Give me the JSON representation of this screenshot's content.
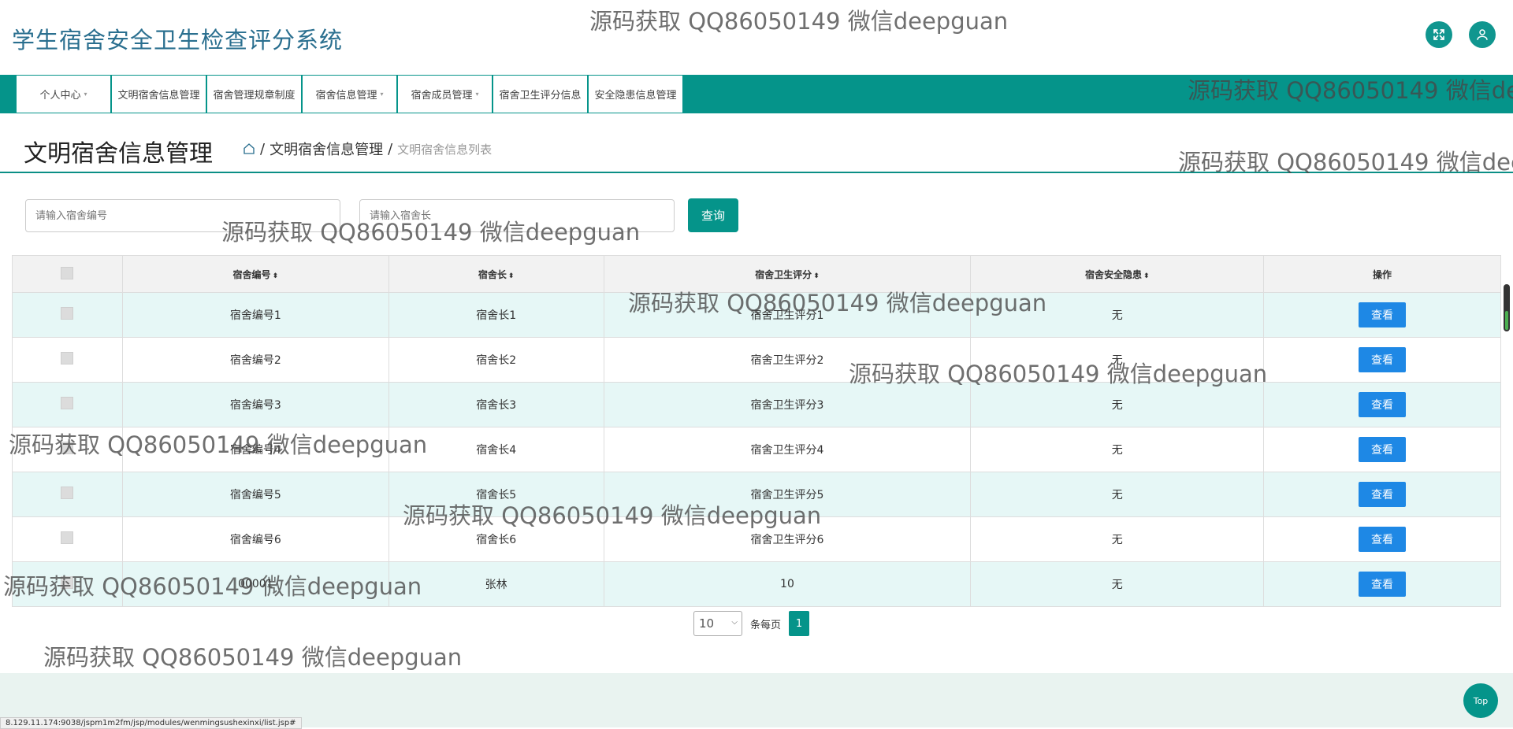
{
  "header": {
    "app_title": "学生宿舍安全卫生检查评分系统"
  },
  "nav": {
    "items": [
      {
        "label": "个人中心",
        "caret": "▾"
      },
      {
        "label": "文明宿舍信息管理",
        "caret": "▾"
      },
      {
        "label": "宿舍管理规章制度",
        "sub": "管理",
        "caret": "▾"
      },
      {
        "label": "宿舍信息管理",
        "caret": "▾"
      },
      {
        "label": "宿舍成员管理",
        "caret": "▾"
      },
      {
        "label": "宿舍卫生评分信息",
        "sub": "管理",
        "caret": "▾"
      },
      {
        "label": "安全隐患信息管理",
        "caret": "▾"
      }
    ]
  },
  "page": {
    "title": "文明宿舍信息管理",
    "breadcrumb": {
      "home_icon": "home-icon",
      "sep": "/",
      "parent": "文明宿舍信息管理",
      "current": "文明宿舍信息列表"
    }
  },
  "search": {
    "dorm_no_placeholder": "请输入宿舍编号",
    "dorm_head_placeholder": "请输入宿舍长",
    "button": "查询"
  },
  "table": {
    "headers": [
      "宿舍编号",
      "宿舍长",
      "宿舍卫生评分",
      "宿舍安全隐患",
      "操作"
    ],
    "sort_glyph": "⬍",
    "action_label": "查看",
    "rows": [
      {
        "no": "宿舍编号1",
        "head": "宿舍长1",
        "score": "宿舍卫生评分1",
        "hazard": "无"
      },
      {
        "no": "宿舍编号2",
        "head": "宿舍长2",
        "score": "宿舍卫生评分2",
        "hazard": "无"
      },
      {
        "no": "宿舍编号3",
        "head": "宿舍长3",
        "score": "宿舍卫生评分3",
        "hazard": "无"
      },
      {
        "no": "宿舍编号4",
        "head": "宿舍长4",
        "score": "宿舍卫生评分4",
        "hazard": "无"
      },
      {
        "no": "宿舍编号5",
        "head": "宿舍长5",
        "score": "宿舍卫生评分5",
        "hazard": "无"
      },
      {
        "no": "宿舍编号6",
        "head": "宿舍长6",
        "score": "宿舍卫生评分6",
        "hazard": "无"
      },
      {
        "no": "00001",
        "head": "张林",
        "score": "10",
        "hazard": "无"
      }
    ]
  },
  "pager": {
    "page_size": "10",
    "per_page_label": "条每页",
    "current_page": "1"
  },
  "footer": {
    "status_url": "8.129.11.174:9038/jspm1m2fm/jsp/modules/wenmingsushexinxi/list.jsp#",
    "top_label": "Top"
  },
  "watermark": {
    "text": "源码获取 QQ86050149 微信deepguan"
  },
  "colors": {
    "primary": "#05948a",
    "view_button": "#1e88e5",
    "row_stripe": "#e6f7f6",
    "title": "#2a6f8f"
  }
}
